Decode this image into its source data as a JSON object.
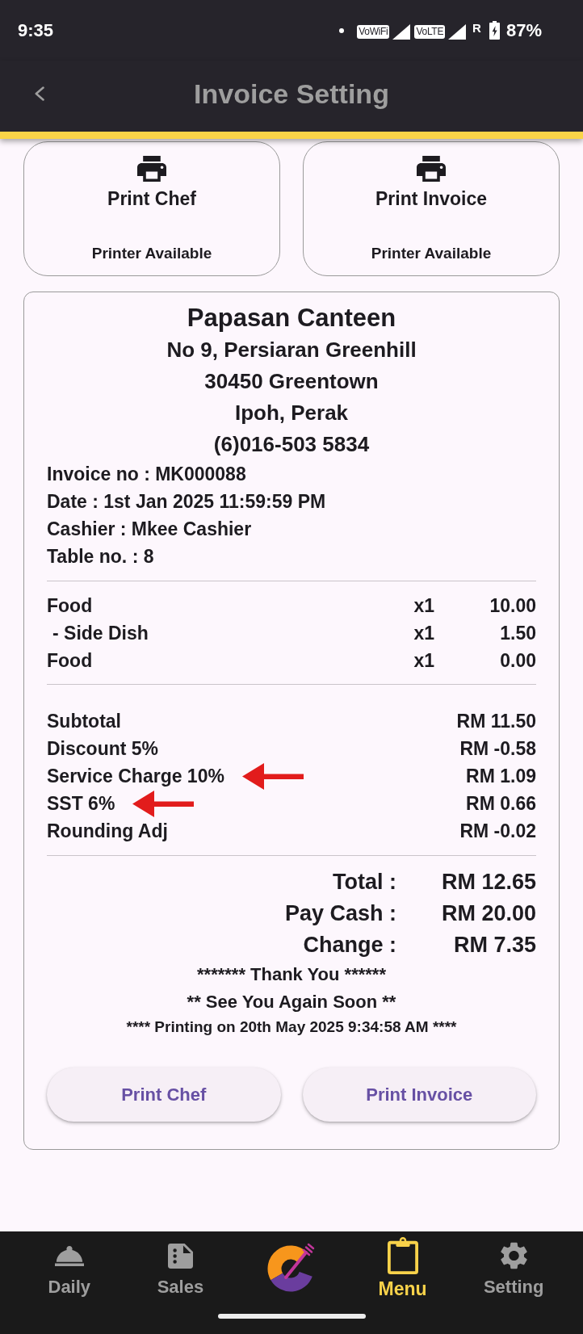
{
  "status_bar": {
    "time": "9:35",
    "network_badges": [
      "VoWiFi",
      "VoLTE"
    ],
    "roaming": "R",
    "battery": "87%"
  },
  "app_bar": {
    "title": "Invoice Setting"
  },
  "printers": [
    {
      "title": "Print Chef",
      "status": "Printer Available"
    },
    {
      "title": "Print Invoice",
      "status": "Printer Available"
    }
  ],
  "receipt": {
    "shop_name": "Papasan Canteen",
    "address_lines": [
      "No 9, Persiaran Greenhill",
      "30450 Greentown",
      "Ipoh, Perak",
      "(6)016-503 5834"
    ],
    "info_lines": [
      "Invoice no : MK000088",
      "Date : 1st Jan 2025 11:59:59 PM",
      "Cashier : Mkee Cashier",
      "Table no. : 8"
    ],
    "items": [
      {
        "name": "Food",
        "qty": "x1",
        "amount": "10.00",
        "children": [
          {
            "name": "- Side Dish",
            "qty": "x1",
            "amount": "1.50"
          }
        ]
      },
      {
        "name": "Food",
        "qty": "x1",
        "amount": "0.00"
      }
    ],
    "summary": [
      {
        "label": "Subtotal",
        "value": "RM 11.50",
        "marked": false
      },
      {
        "label": "Discount 5%",
        "value": "RM -0.58",
        "marked": false
      },
      {
        "label": "Service Charge 10%",
        "value": "RM 1.09",
        "marked": true
      },
      {
        "label": "SST 6%",
        "value": "RM 0.66",
        "marked": true
      },
      {
        "label": "Rounding Adj",
        "value": "RM -0.02",
        "marked": false
      }
    ],
    "totals": [
      {
        "label": "Total :",
        "value": "RM 12.65"
      },
      {
        "label": "Pay Cash :",
        "value": "RM 20.00"
      },
      {
        "label": "Change :",
        "value": "RM 7.35"
      }
    ],
    "thanks_lines": [
      "******* Thank You ******",
      "** See You Again Soon **"
    ],
    "print_time": "**** Printing on 20th May 2025 9:34:58 AM ****",
    "buttons": [
      "Print Chef",
      "Print Invoice"
    ]
  },
  "bottom_nav": [
    {
      "kind": "tab",
      "label": "Daily",
      "selected": false
    },
    {
      "kind": "tab",
      "label": "Sales",
      "selected": false
    },
    {
      "kind": "logo"
    },
    {
      "kind": "tab",
      "label": "Menu",
      "selected": true
    },
    {
      "kind": "tab",
      "label": "Setting",
      "selected": false
    }
  ]
}
